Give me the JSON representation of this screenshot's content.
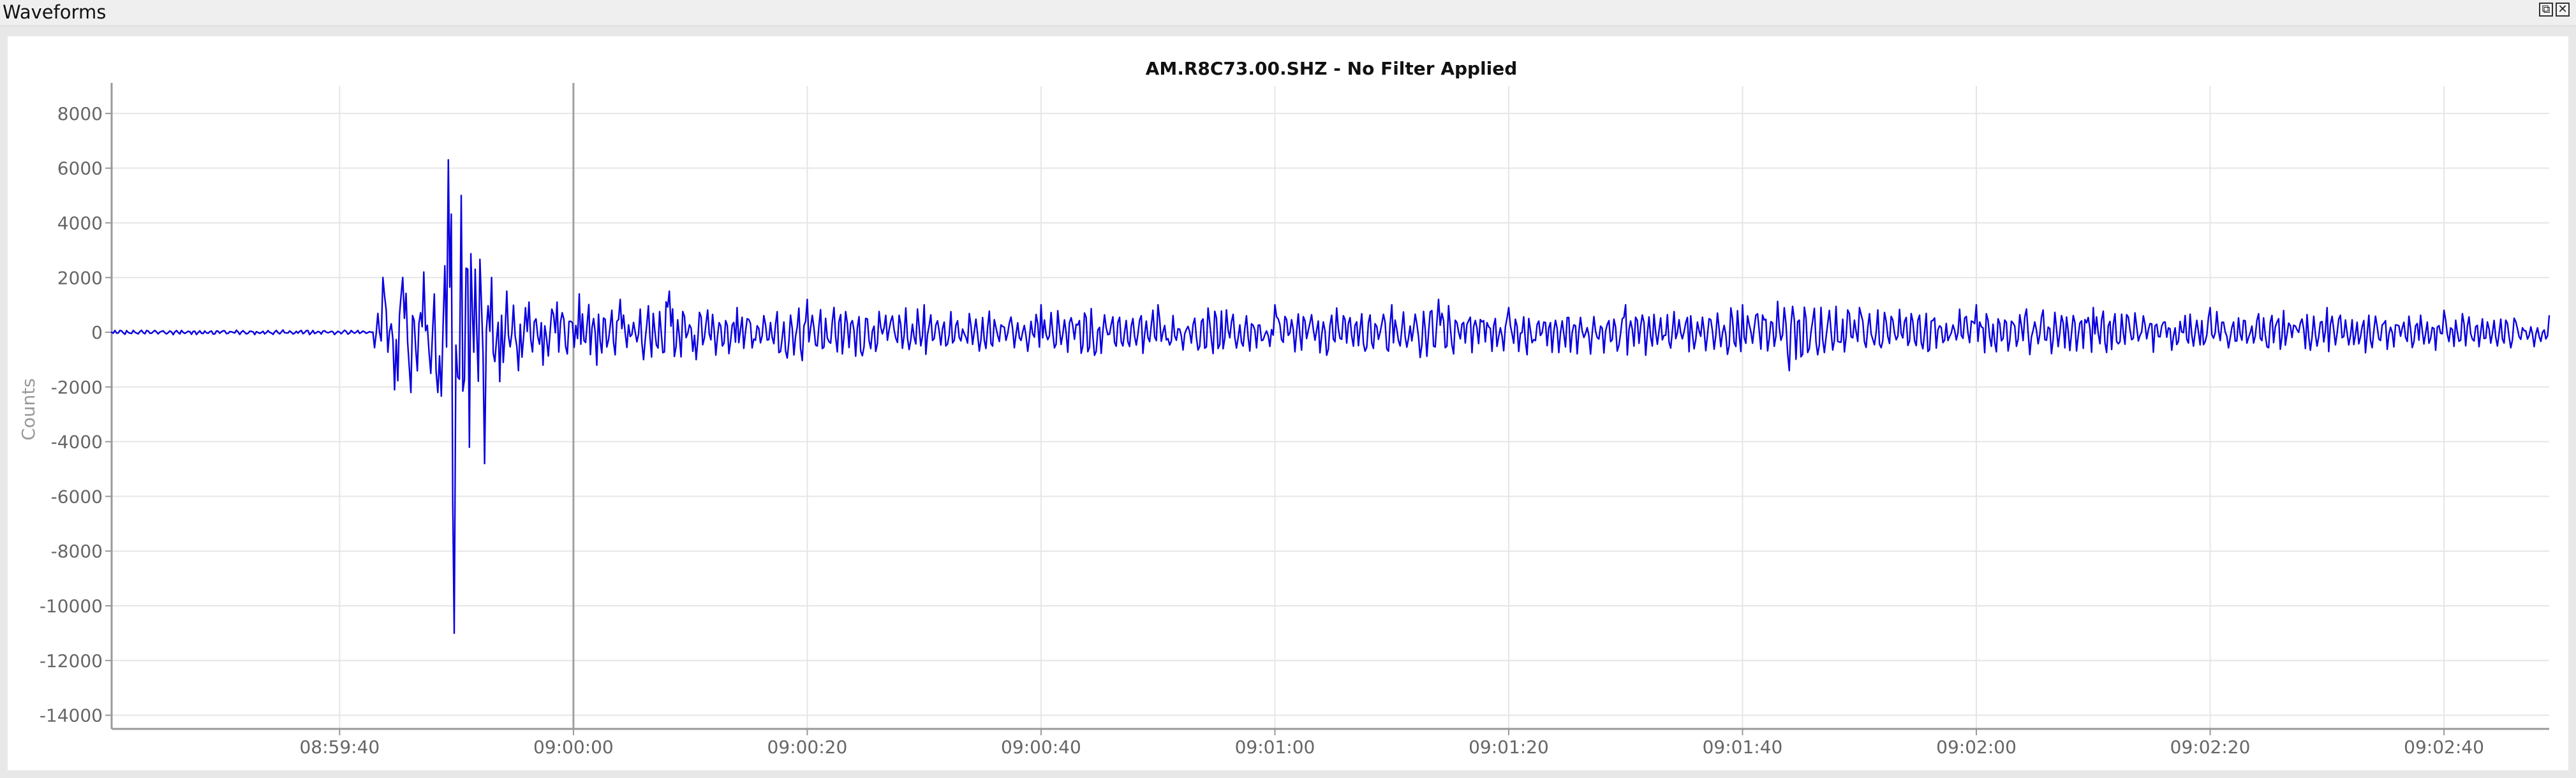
{
  "window": {
    "title": "Waveforms",
    "float_glyph": "⧉",
    "close_glyph": "✕"
  },
  "colors": {
    "trace": "#0a00e0",
    "grid": "#e6e6e6",
    "axis": "#999999",
    "cursor": "#a0a0a0",
    "panel": "#ffffff",
    "background": "#e8e8e8"
  },
  "chart_data": {
    "type": "line",
    "title": "AM.R8C73.00.SHZ - No Filter Applied",
    "ylabel": "Counts",
    "xlabel": "",
    "x_range": [
      "08:59:20.5",
      "09:02:49"
    ],
    "ylim": [
      -14500,
      9000
    ],
    "yticks": [
      8000,
      6000,
      4000,
      2000,
      0,
      -2000,
      -4000,
      -6000,
      -8000,
      -10000,
      -12000,
      -14000
    ],
    "yticklabels": [
      "8000",
      "6000",
      "4000",
      "2000",
      "0",
      "-2000",
      "-4000",
      "-6000",
      "-8000",
      "-10000",
      "-12000",
      "-14000"
    ],
    "xticklabels": [
      "08:59:40",
      "09:00:00",
      "09:00:20",
      "09:00:40",
      "09:01:00",
      "09:01:20",
      "09:01:40",
      "09:02:00",
      "09:02:20",
      "09:02:40"
    ],
    "grid": true,
    "legend": "none",
    "cursor_line_at": "09:00:00",
    "series": [
      {
        "x": [
          "08:59:20.5",
          "08:59:42.7",
          "08:59:43.7",
          "08:59:44.7",
          "08:59:45.4",
          "08:59:46.1",
          "08:59:47.2",
          "08:59:48.4",
          "08:59:49.3",
          "08:59:49.8",
          "08:59:50.4",
          "08:59:51.1",
          "08:59:51.6",
          "08:59:52.4",
          "08:59:53.0",
          "08:59:53.7",
          "08:59:54.3",
          "08:59:55.3",
          "08:59:56.2",
          "08:59:57.4",
          "08:59:58.6",
          "09:00:00.5",
          "09:00:02.0",
          "09:00:04.0",
          "09:00:06.0",
          "09:00:08.2",
          "09:00:10.5",
          "09:00:14",
          "09:00:20",
          "09:00:30",
          "09:00:40",
          "09:00:50",
          "09:01:00",
          "09:01:10",
          "09:01:14",
          "09:01:20",
          "09:01:30",
          "09:01:40",
          "09:01:44",
          "09:01:50",
          "09:02:00",
          "09:02:10",
          "09:02:20",
          "09:02:30",
          "09:02:40",
          "09:02:49"
        ],
        "y": [
          0,
          0,
          2000,
          -2100,
          2000,
          -2200,
          2200,
          -2200,
          6300,
          -11000,
          5000,
          -4200,
          2300,
          -4800,
          2000,
          -1800,
          1500,
          -1400,
          1100,
          -1200,
          1100,
          1400,
          -1200,
          1200,
          -1000,
          1500,
          -1000,
          900,
          1200,
          1000,
          1000,
          1000,
          1000,
          1000,
          1200,
          900,
          1000,
          1000,
          -1400,
          900,
          1000,
          900,
          900,
          900,
          800,
          600
        ],
        "envelope_amplitude": [
          100,
          100,
          2000,
          2100,
          2000,
          2200,
          2200,
          2200,
          6300,
          11000,
          5000,
          4200,
          2300,
          4800,
          2000,
          1800,
          1500,
          1400,
          1100,
          1200,
          1100,
          1400,
          1200,
          1200,
          1000,
          1500,
          1000,
          900,
          1200,
          1000,
          1000,
          1000,
          1000,
          1000,
          1200,
          900,
          1000,
          1000,
          1400,
          900,
          1000,
          900,
          900,
          900,
          800,
          600
        ]
      }
    ]
  }
}
